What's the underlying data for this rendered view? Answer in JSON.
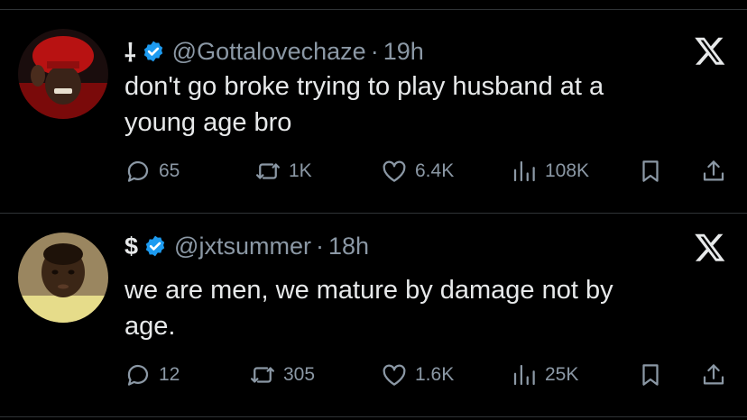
{
  "colors": {
    "background": "#000000",
    "text": "#e7e9ea",
    "muted": "#8b98a5",
    "verified": "#1d9bf0",
    "divider": "#2f3336"
  },
  "tweets": [
    {
      "name": "⸸",
      "handle": "@Gottalovechaze",
      "time": "19h",
      "separator": "·",
      "text_line1": "don't go broke trying to play husband at a",
      "text_line2": "young age bro",
      "replies": "65",
      "reposts": "1K",
      "likes": "6.4K",
      "views": "108K",
      "avatar": "red-hoodie-portrait"
    },
    {
      "name": "$",
      "handle": "@jxtsummer",
      "time": "18h",
      "separator": "·",
      "text_line1": "we are men, we mature by damage not by",
      "text_line2": "age.",
      "replies": "12",
      "reposts": "305",
      "likes": "1.6K",
      "views": "25K",
      "avatar": "child-portrait"
    }
  ]
}
